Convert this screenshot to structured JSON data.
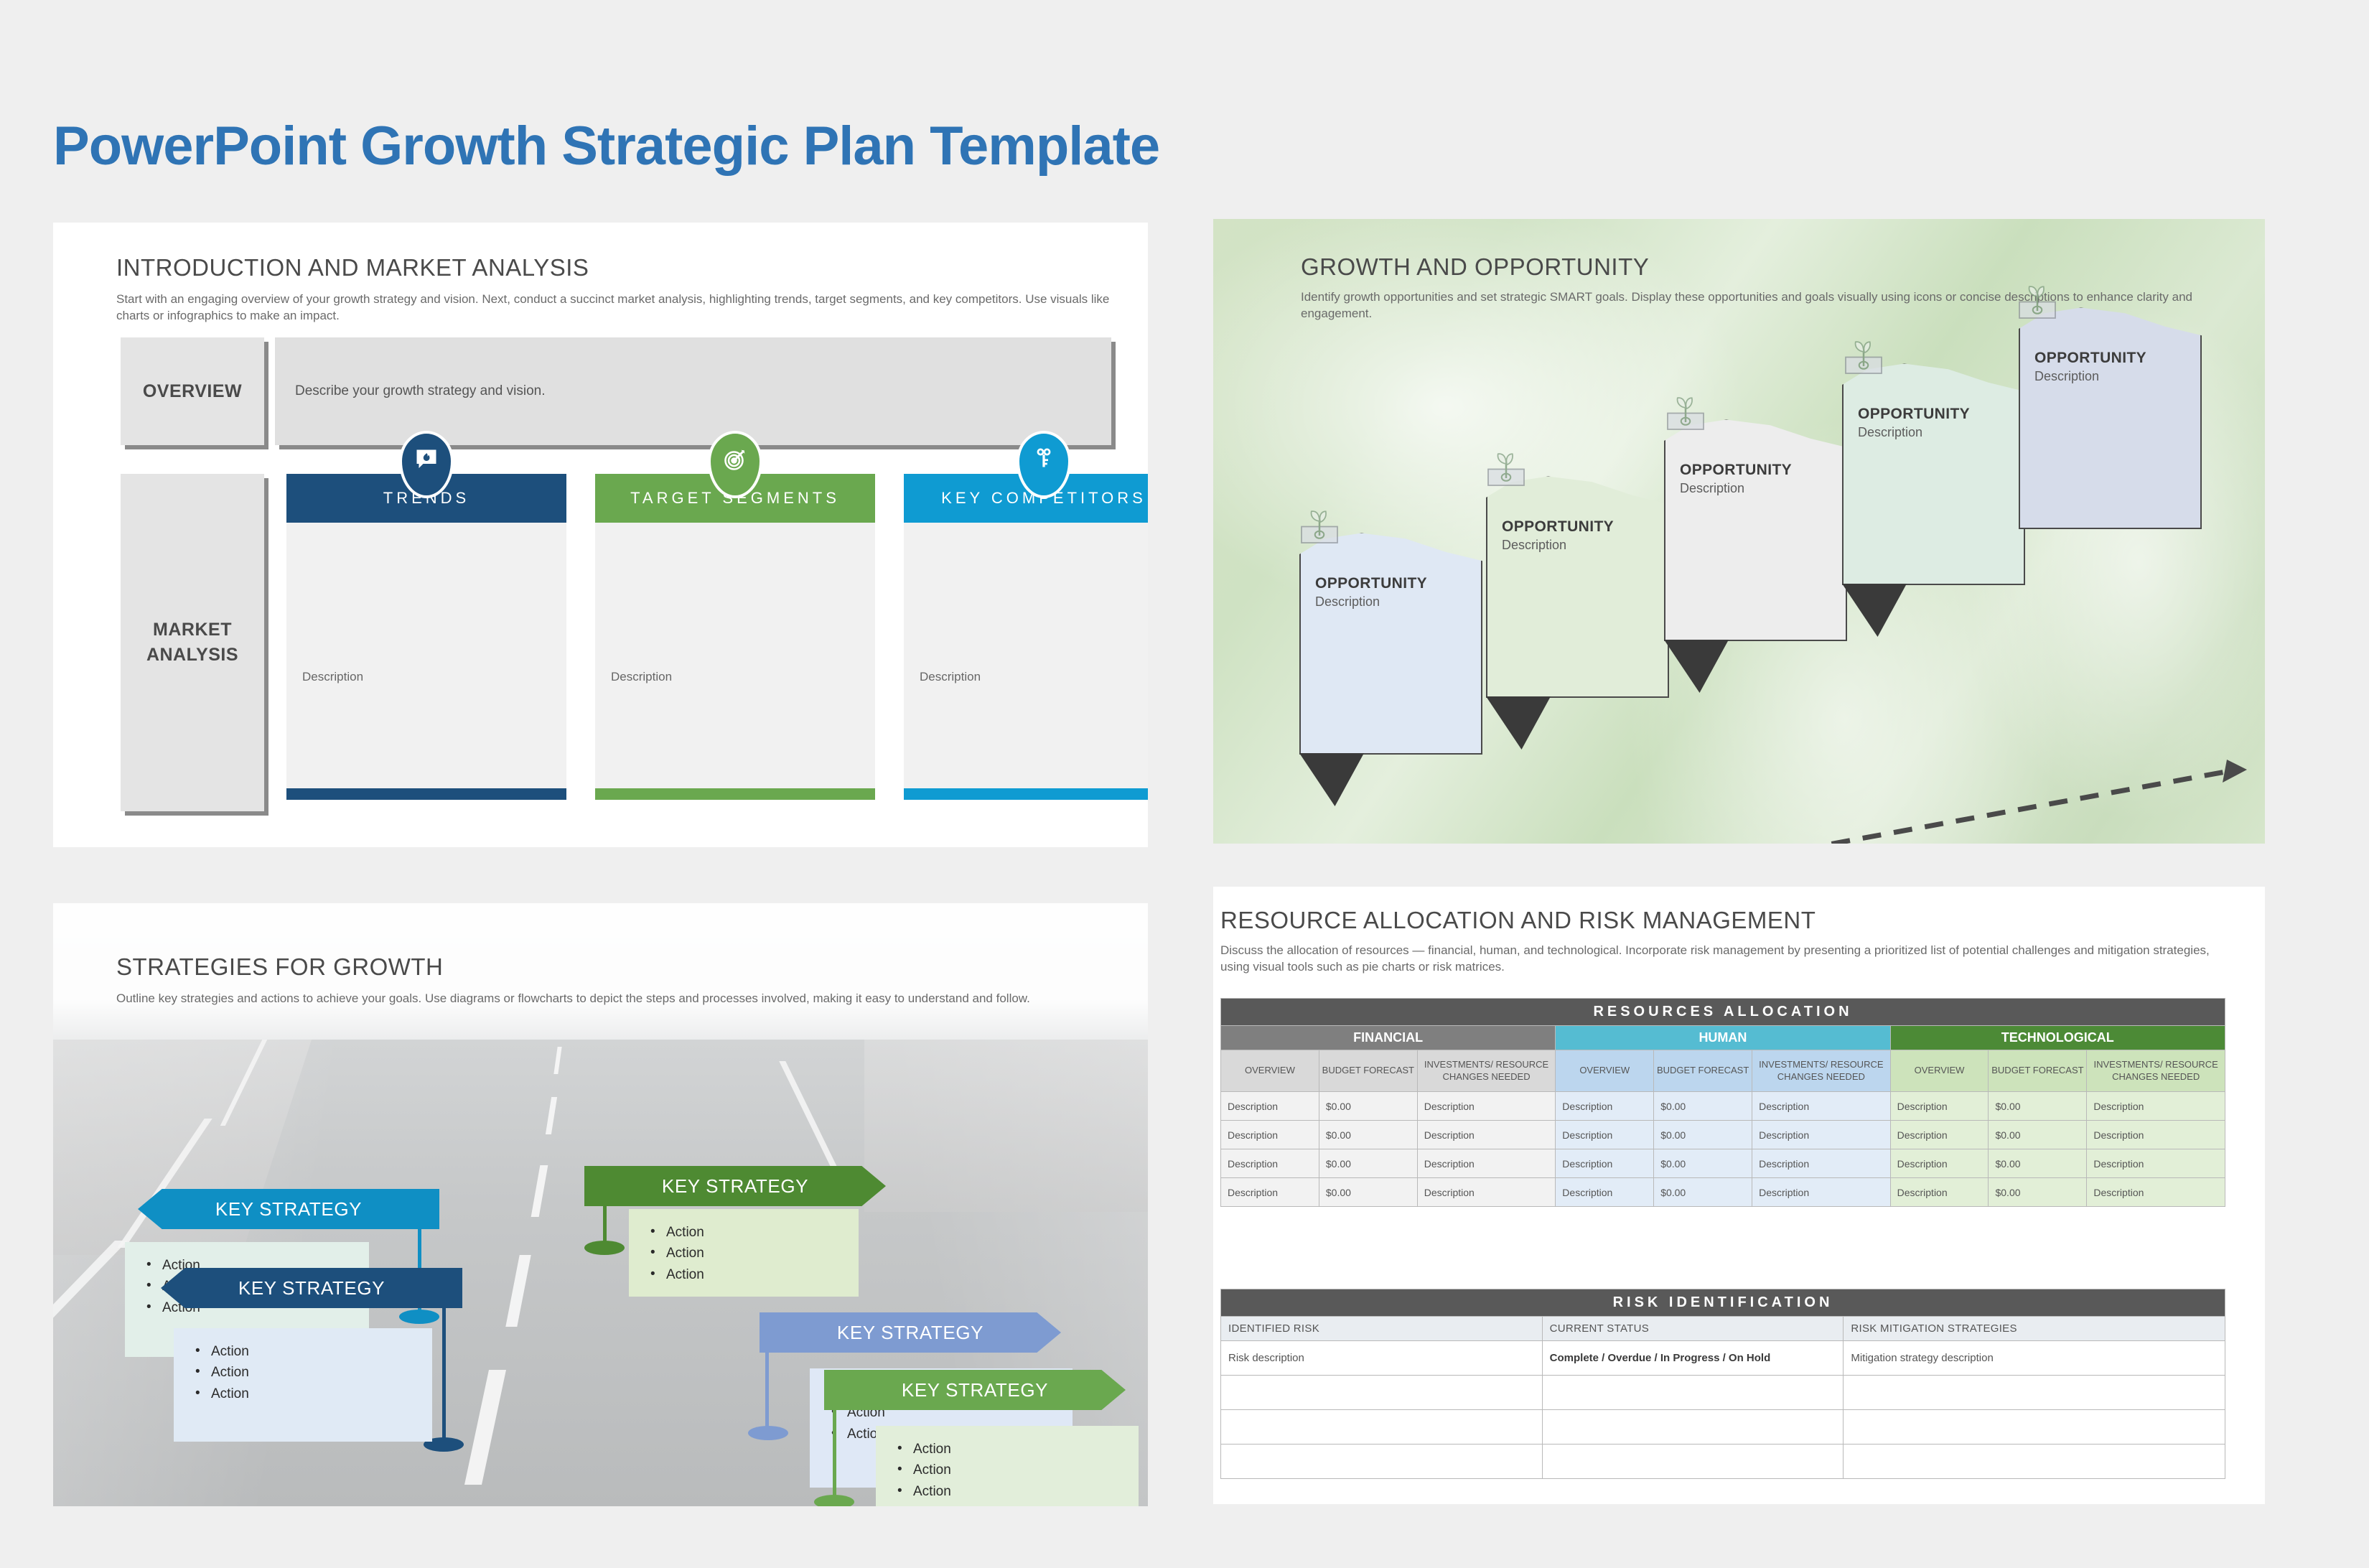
{
  "title": "PowerPoint Growth Strategic Plan Template",
  "colors": {
    "title_blue": "#2f74b5",
    "navy": "#1d4f7c",
    "green": "#6aa84f",
    "cyan": "#0f9bd2",
    "band_gray": "#595959",
    "financial_gray": "#7f7f7f",
    "human_cyan": "#55bcd2",
    "technological_green": "#4c8a36"
  },
  "intro": {
    "heading": "INTRODUCTION AND MARKET ANALYSIS",
    "subtext": "Start with an engaging overview of your growth strategy and vision. Next, conduct a succinct market analysis, highlighting trends, target segments, and key competitors. Use visuals like charts or infographics to make an impact.",
    "overview_label": "OVERVIEW",
    "overview_text": "Describe your growth strategy and vision.",
    "market_label_line1": "MARKET",
    "market_label_line2": "ANALYSIS",
    "columns": [
      {
        "label": "TRENDS",
        "description": "Description",
        "color": "#1d4f7c",
        "icon": "flame-chat-icon"
      },
      {
        "label": "TARGET SEGMENTS",
        "description": "Description",
        "color": "#6aa84f",
        "icon": "target-dart-icon"
      },
      {
        "label": "KEY COMPETITORS",
        "description": "Description",
        "color": "#0f9bd2",
        "icon": "key-icon"
      }
    ]
  },
  "growth": {
    "heading": "GROWTH AND OPPORTUNITY",
    "subtext": "Identify growth opportunities and set strategic SMART goals. Display these opportunities and goals visually using icons or concise descriptions to enhance clarity and engagement.",
    "cards": [
      {
        "title": "OPPORTUNITY",
        "description": "Description",
        "fill": "#dfe8f4",
        "icon": "sprout-icon"
      },
      {
        "title": "OPPORTUNITY",
        "description": "Description",
        "fill": "#e1edd9",
        "icon": "sprout-icon"
      },
      {
        "title": "OPPORTUNITY",
        "description": "Description",
        "fill": "#ededed",
        "icon": "sprout-icon"
      },
      {
        "title": "OPPORTUNITY",
        "description": "Description",
        "fill": "#ddece3",
        "icon": "sprout-icon"
      },
      {
        "title": "OPPORTUNITY",
        "description": "Description",
        "fill": "#d6dcea",
        "icon": "sprout-icon"
      }
    ]
  },
  "strategies": {
    "heading": "STRATEGIES FOR GROWTH",
    "subtext": "Outline key strategies and actions to achieve your goals. Use diagrams or flowcharts to depict the steps and processes involved, making it easy to understand and follow.",
    "items": [
      {
        "label": "KEY STRATEGY",
        "color": "#0f8fc4",
        "box_fill": "#e2efe9",
        "actions": [
          "Action",
          "Action",
          "Action"
        ]
      },
      {
        "label": "KEY STRATEGY",
        "color": "#4e8a32",
        "box_fill": "#dfeccf",
        "actions": [
          "Action",
          "Action",
          "Action"
        ]
      },
      {
        "label": "KEY STRATEGY",
        "color": "#7e9bd1",
        "box_fill": "#dfe8f6",
        "actions": [
          "Action",
          "Action",
          "Action"
        ]
      },
      {
        "label": "KEY STRATEGY",
        "color": "#1d4f7c",
        "box_fill": "#e0eaf5",
        "actions": [
          "Action",
          "Action",
          "Action"
        ]
      },
      {
        "label": "KEY STRATEGY",
        "color": "#6aa84f",
        "box_fill": "#e2eeda",
        "actions": [
          "Action",
          "Action",
          "Action"
        ]
      }
    ]
  },
  "resources": {
    "heading": "RESOURCE ALLOCATION AND RISK MANAGEMENT",
    "subtext": "Discuss the allocation of resources — financial, human, and technological. Incorporate risk management by presenting a prioritized list of potential challenges and mitigation strategies, using visual tools such as pie charts or risk matrices.",
    "allocation": {
      "band": "RESOURCES ALLOCATION",
      "groups": [
        "FINANCIAL",
        "HUMAN",
        "TECHNOLOGICAL"
      ],
      "subheaders": [
        "OVERVIEW",
        "BUDGET FORECAST",
        "INVESTMENTS/ RESOURCE CHANGES NEEDED"
      ],
      "rows": [
        [
          "Description",
          "$0.00",
          "Description",
          "Description",
          "$0.00",
          "Description",
          "Description",
          "$0.00",
          "Description"
        ],
        [
          "Description",
          "$0.00",
          "Description",
          "Description",
          "$0.00",
          "Description",
          "Description",
          "$0.00",
          "Description"
        ],
        [
          "Description",
          "$0.00",
          "Description",
          "Description",
          "$0.00",
          "Description",
          "Description",
          "$0.00",
          "Description"
        ],
        [
          "Description",
          "$0.00",
          "Description",
          "Description",
          "$0.00",
          "Description",
          "Description",
          "$0.00",
          "Description"
        ]
      ]
    },
    "risk": {
      "band": "RISK IDENTIFICATION",
      "headers": [
        "IDENTIFIED RISK",
        "CURRENT STATUS",
        "RISK MITIGATION STRATEGIES"
      ],
      "rows": [
        [
          "Risk description",
          "Complete / Overdue / In Progress / On Hold",
          "Mitigation strategy description"
        ],
        [
          "",
          "",
          ""
        ],
        [
          "",
          "",
          ""
        ],
        [
          "",
          "",
          ""
        ]
      ]
    }
  }
}
